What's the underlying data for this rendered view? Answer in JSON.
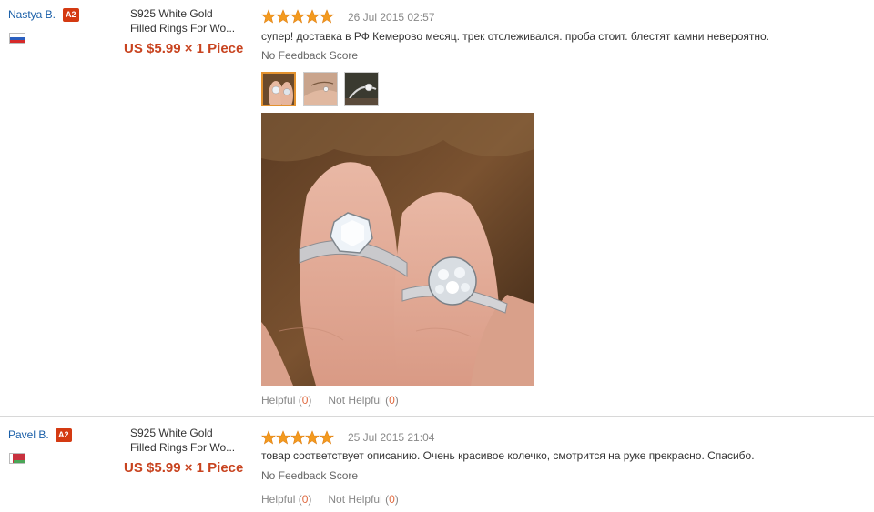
{
  "reviews": [
    {
      "user": "Nastya B.",
      "level": "A2",
      "country_flag": "flag-russia",
      "product_line1": "S925 White Gold",
      "product_line2": "Filled Rings For Wo...",
      "price": "US $5.99 × 1 Piece",
      "rating": 5,
      "date": "26 Jul 2015 02:57",
      "feedback": "супер! доставка в РФ Кемерово месяц. трек отслеживался. проба стоит. блестят камни невероятно.",
      "score": "No Feedback Score",
      "helpful_label": "Helpful",
      "helpful_count": "0",
      "not_helpful_label": "Not Helpful",
      "not_helpful_count": "0",
      "photos": 3
    },
    {
      "user": "Pavel B.",
      "level": "A2",
      "country_flag": "flag-belarus",
      "product_line1": "S925 White Gold",
      "product_line2": "Filled Rings For Wo...",
      "price": "US $5.99 × 1 Piece",
      "rating": 5,
      "date": "25 Jul 2015 21:04",
      "feedback": "товар соответствует описанию. Очень красивое колечко, смотрится на руке прекрасно. Спасибо.",
      "score": "No Feedback Score",
      "helpful_label": "Helpful",
      "helpful_count": "0",
      "not_helpful_label": "Not Helpful",
      "not_helpful_count": "0"
    }
  ],
  "colors": {
    "link": "#1a5fa8",
    "price": "#c8431f",
    "badge": "#d43a12",
    "star": "#f39a1f",
    "count": "#e0693f"
  }
}
